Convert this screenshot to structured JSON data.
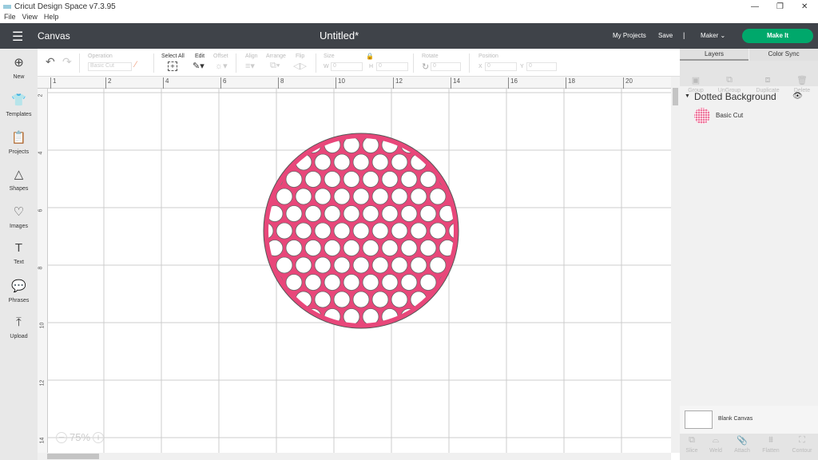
{
  "window": {
    "title": "Cricut Design Space  v7.3.95",
    "menu": [
      "File",
      "View",
      "Help"
    ]
  },
  "header": {
    "section": "Canvas",
    "doc_title": "Untitled*",
    "my_projects": "My Projects",
    "save": "Save",
    "divider": "|",
    "machine": "Maker",
    "make_it": "Make It",
    "accent": "#00a86b"
  },
  "sidebar": {
    "items": [
      {
        "label": "New",
        "icon": "plus-circle"
      },
      {
        "label": "Templates",
        "icon": "shirt"
      },
      {
        "label": "Projects",
        "icon": "clipboard"
      },
      {
        "label": "Shapes",
        "icon": "shapes"
      },
      {
        "label": "Images",
        "icon": "lightbulb"
      },
      {
        "label": "Text",
        "icon": "T"
      },
      {
        "label": "Phrases",
        "icon": "speech-bubble"
      },
      {
        "label": "Upload",
        "icon": "upload-arrow"
      }
    ]
  },
  "toolbar": {
    "operation_label": "Operation",
    "operation_value": "Basic Cut",
    "select_all": "Select All",
    "edit": "Edit",
    "offset": "Offset",
    "align": "Align",
    "arrange": "Arrange",
    "flip": "Flip",
    "size": "Size",
    "w": "W",
    "h": "H",
    "w_value": "0",
    "h_value": "0",
    "rotate": "Rotate",
    "rotate_value": "0",
    "position": "Position",
    "x": "X",
    "y": "Y",
    "x_value": "0",
    "y_value": "0"
  },
  "ruler": {
    "h_ticks": [
      "1",
      "2",
      "4",
      "6",
      "8",
      "10",
      "12",
      "14",
      "16",
      "18",
      "20"
    ],
    "v_ticks": [
      "2",
      "4",
      "6",
      "8",
      "10",
      "12",
      "14"
    ]
  },
  "zoom": {
    "value": "75%",
    "minus": "−",
    "plus": "+"
  },
  "design": {
    "fill": "#e8477a"
  },
  "panel": {
    "tabs": [
      "Layers",
      "Color Sync"
    ],
    "actions": [
      "Group",
      "UnGroup",
      "Duplicate",
      "Delete"
    ],
    "layer_group": "Dotted Background",
    "layer_item": "Basic Cut",
    "blank_canvas": "Blank Canvas",
    "bottom_actions": [
      "Slice",
      "Weld",
      "Attach",
      "Flatten",
      "Contour"
    ]
  }
}
